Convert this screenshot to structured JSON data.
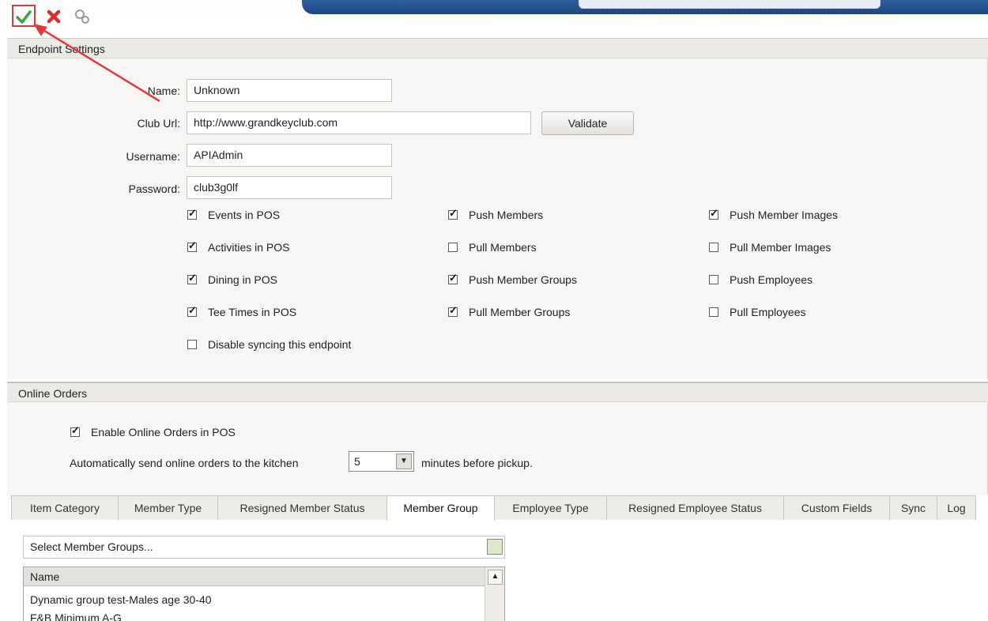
{
  "toolbar": {
    "save_icon": "checkmark-icon",
    "cancel_icon": "red-x-icon",
    "tools_icon": "gears-icon",
    "accent_red": "#e23a3a"
  },
  "endpoint": {
    "title": "Endpoint Settings",
    "name_label": "Name:",
    "name_value": "Unknown",
    "url_label": "Club Url:",
    "url_value": "http://www.grandkeyclub.com",
    "validate_label": "Validate",
    "username_label": "Username:",
    "username_value": "APIAdmin",
    "password_label": "Password:",
    "password_value": "club3g0lf",
    "checkboxes": [
      {
        "label": "Events in POS",
        "checked": true
      },
      {
        "label": "Activities in POS",
        "checked": true
      },
      {
        "label": "Dining in POS",
        "checked": true
      },
      {
        "label": "Tee Times in POS",
        "checked": true
      },
      {
        "label": "Disable syncing this endpoint",
        "checked": false
      },
      {
        "label": "Push Members",
        "checked": true
      },
      {
        "label": "Pull Members",
        "checked": false
      },
      {
        "label": "Push Member Groups",
        "checked": true
      },
      {
        "label": "Pull Member Groups",
        "checked": true
      },
      {
        "label": "Push Member Images",
        "checked": true
      },
      {
        "label": "Pull Member Images",
        "checked": false
      },
      {
        "label": "Push Employees",
        "checked": false
      },
      {
        "label": "Pull Employees",
        "checked": false
      }
    ]
  },
  "online": {
    "title": "Online Orders",
    "enable_label": "Enable Online Orders in POS",
    "enable_checked": true,
    "send_before": "Automatically send online orders to the kitchen",
    "minutes_value": "5",
    "send_after": "minutes before pickup."
  },
  "tabs": [
    {
      "label": "Item Category"
    },
    {
      "label": "Member Type"
    },
    {
      "label": "Resigned Member Status"
    },
    {
      "label": "Member Group",
      "active": true
    },
    {
      "label": "Employee Type"
    },
    {
      "label": "Resigned Employee Status"
    },
    {
      "label": "Custom Fields"
    },
    {
      "label": "Sync"
    },
    {
      "label": "Log"
    }
  ],
  "member_group": {
    "select_placeholder": "Select Member Groups...",
    "column_name": "Name",
    "rows": [
      "Dynamic group test-Males age 30-40",
      "F&B Minimum A-G"
    ]
  }
}
